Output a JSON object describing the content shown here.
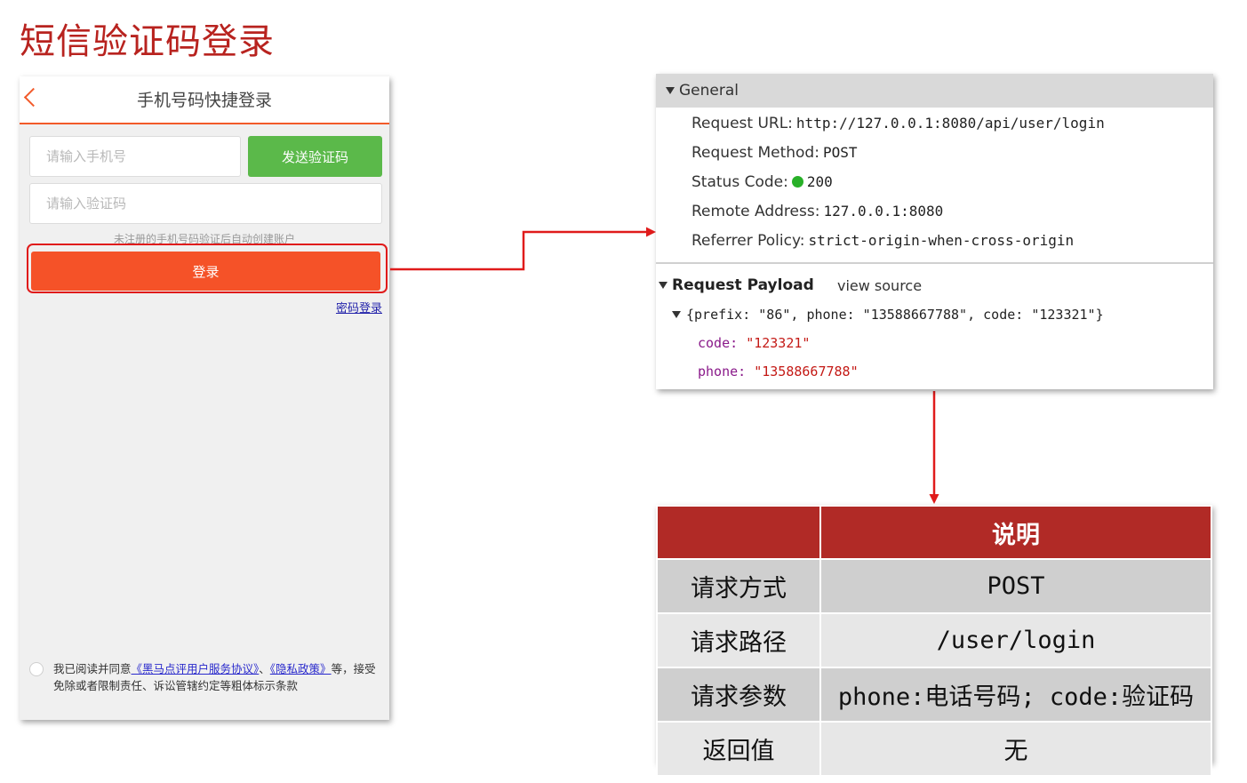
{
  "slide": {
    "title": "短信验证码登录"
  },
  "phone": {
    "header_title": "手机号码快捷登录",
    "phone_placeholder": "请输入手机号",
    "send_code_label": "发送验证码",
    "code_placeholder": "请输入验证码",
    "hint": "未注册的手机号码验证后自动创建账户",
    "login_label": "登录",
    "password_login_link": "密码登录",
    "agreement": {
      "prefix": "我已阅读并同意",
      "link1": "《黑马点评用户服务协议》",
      "sep": "、",
      "link2": "《隐私政策》",
      "suffix": "等，接受免除或者限制责任、诉讼管辖约定等粗体标示条款"
    }
  },
  "devtools": {
    "general_label": "General",
    "request_url_key": "Request URL:",
    "request_url": "http://127.0.0.1:8080/api/user/login",
    "request_method_key": "Request Method:",
    "request_method": "POST",
    "status_code_key": "Status Code:",
    "status_code": "200",
    "remote_address_key": "Remote Address:",
    "remote_address": "127.0.0.1:8080",
    "referrer_policy_key": "Referrer Policy:",
    "referrer_policy": "strict-origin-when-cross-origin",
    "payload_label": "Request Payload",
    "view_source": "view source",
    "payload_json": "{prefix: \"86\", phone: \"13588667788\", code: \"123321\"}",
    "field_code_key": "code:",
    "field_code_value": "\"123321\"",
    "field_phone_key": "phone:",
    "field_phone_value": "\"13588667788\"",
    "status_color": "#28b028"
  },
  "table": {
    "header_blank": "",
    "header": "说明",
    "rows": [
      {
        "label": "请求方式",
        "value": "POST"
      },
      {
        "label": "请求路径",
        "value": "/user/login"
      },
      {
        "label": "请求参数",
        "value": "phone:电话号码; code:验证码"
      },
      {
        "label": "返回值",
        "value": "无"
      }
    ]
  },
  "colors": {
    "title": "#b8231f",
    "accent_orange": "#f55228",
    "send_green": "#5bb94a",
    "highlight_red": "#e01b1b",
    "table_header": "#b12a26"
  }
}
